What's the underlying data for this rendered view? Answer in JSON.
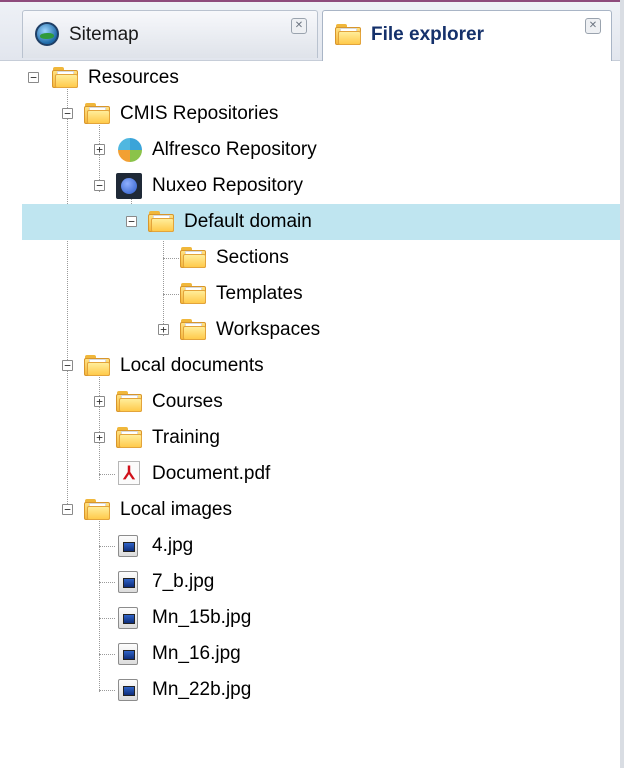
{
  "tabs": [
    {
      "label": "Sitemap",
      "icon": "globe-icon",
      "active": false
    },
    {
      "label": "File explorer",
      "icon": "folder-icon",
      "active": true
    }
  ],
  "tree": {
    "resources": "Resources",
    "cmis_repositories": "CMIS Repositories",
    "alfresco": "Alfresco Repository",
    "nuxeo": "Nuxeo Repository",
    "default_domain": "Default domain",
    "sections": "Sections",
    "templates": "Templates",
    "workspaces": "Workspaces",
    "local_documents": "Local documents",
    "courses": "Courses",
    "training": "Training",
    "document_pdf": "Document.pdf",
    "local_images": "Local images",
    "img_4": "4.jpg",
    "img_7b": "7_b.jpg",
    "img_mn15b": "Mn_15b.jpg",
    "img_mn16": "Mn_16.jpg",
    "img_mn22b": "Mn_22b.jpg"
  },
  "selected_node": "Default domain",
  "colors": {
    "selection": "#bfe5f0",
    "accent_line": "#8e4b7c",
    "active_tab_text": "#15316b"
  }
}
